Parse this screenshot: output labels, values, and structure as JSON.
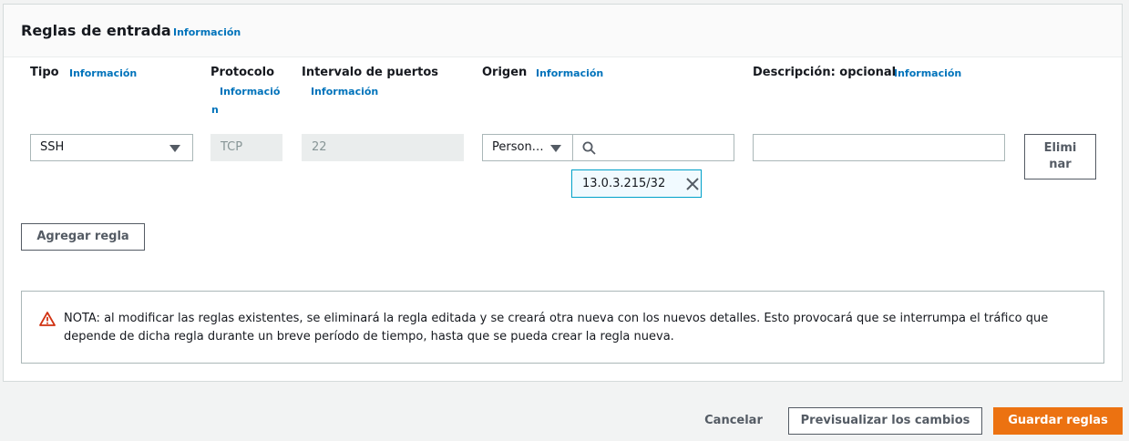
{
  "panel": {
    "title": "Reglas de entrada",
    "title_info": "Información"
  },
  "columns": {
    "tipo": {
      "label": "Tipo",
      "info": "Información"
    },
    "protocolo": {
      "label": "Protocolo",
      "info_line1": "Informació",
      "info_line2": "n"
    },
    "puertos": {
      "label": "Intervalo de puertos",
      "info": "Información"
    },
    "origen": {
      "label": "Origen",
      "info": "Información"
    },
    "descripcion": {
      "label": "Descripción: opcional",
      "info": "Información"
    }
  },
  "rule": {
    "tipo_value": "SSH",
    "protocolo_value": "TCP",
    "puertos_value": "22",
    "origen_select": "Person…",
    "origen_search_placeholder": "",
    "origen_token": "13.0.3.215/32",
    "descripcion_value": "",
    "delete_label_line1": "Elimi",
    "delete_label_line2": "nar"
  },
  "add_rule_label": "Agregar regla",
  "alert": {
    "text": "NOTA: al modificar las reglas existentes, se eliminará la regla editada y se creará otra nueva con los nuevos detalles. Esto provocará que se interrumpa el tráfico que depende de dicha regla durante un breve período de tiempo, hasta que se pueda crear la regla nueva.",
    "icon": "warning-icon",
    "color": "#d13212"
  },
  "footer": {
    "cancel_label": "Cancelar",
    "preview_label": "Previsualizar los cambios",
    "save_label": "Guardar reglas",
    "primary_color": "#ec7211"
  }
}
